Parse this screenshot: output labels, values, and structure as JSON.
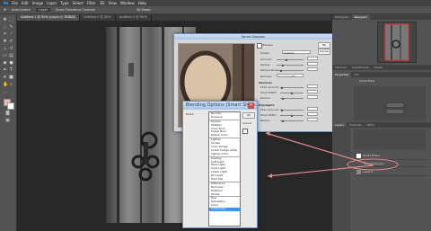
{
  "menubar": {
    "items": [
      "Ps",
      "File",
      "Edit",
      "Image",
      "Layer",
      "Type",
      "Select",
      "Filter",
      "3D",
      "View",
      "Window",
      "Help"
    ]
  },
  "optionsbar": {
    "items": [
      "Auto-Select:",
      "Layer",
      "Show Transform Controls",
      "3D Mode:"
    ]
  },
  "document_tabs": [
    {
      "label": "Untitled-1 @ 50% (Layer 0, RGB/8)"
    },
    {
      "label": "Untitled-2 @ 50%"
    },
    {
      "label": "Untitled-3 @ 50%"
    }
  ],
  "smart_sharpen": {
    "title": "Smart Sharpen",
    "preview_label": "Preview",
    "labels": [
      "Preset:",
      "Amount:",
      "Radius:",
      "Reduce Noise:",
      "Remove:",
      "Shadows",
      "Fade Amount:",
      "Tonal Width:",
      "Radius:",
      "Highlights",
      "Fade Amount:",
      "Tonal Width:",
      "Radius:"
    ],
    "ok": "OK",
    "cancel": "Cancel",
    "preset_value": "Custom",
    "remove_value": "Gaussian Blur"
  },
  "blending": {
    "title": "Blending Options (Smart Sharp...",
    "mode_label": "Mode:",
    "ok": "OK",
    "cancel": "Cancel",
    "modes": [
      "Normal",
      "Dissolve",
      "Darken",
      "Multiply",
      "Color Burn",
      "Linear Burn",
      "Darker Color",
      "Lighten",
      "Screen",
      "Color Dodge",
      "Linear Dodge (Add)",
      "Lighter Color",
      "Overlay",
      "Soft Light",
      "Hard Light",
      "Vivid Light",
      "Linear Light",
      "Pin Light",
      "Hard Mix",
      "Difference",
      "Exclusion",
      "Subtract",
      "Divide",
      "Hue",
      "Saturation",
      "Color",
      "Luminosity"
    ],
    "selected_mode": "Luminosity"
  },
  "panels": {
    "navigator_tabs": [
      "Histogram",
      "Navigator"
    ],
    "adjust_tabs": [
      "Libraries",
      "Adjustments",
      "Styles"
    ],
    "properties_tabs": [
      "Properties",
      "Info"
    ],
    "properties_title": "Smart Filter",
    "layers_tabs": [
      "Layers",
      "Channels",
      "Paths"
    ],
    "layers": [
      {
        "name": "Smart Filters"
      },
      {
        "name": "Smart Sharpen"
      },
      {
        "name": "Layer 0"
      }
    ]
  }
}
